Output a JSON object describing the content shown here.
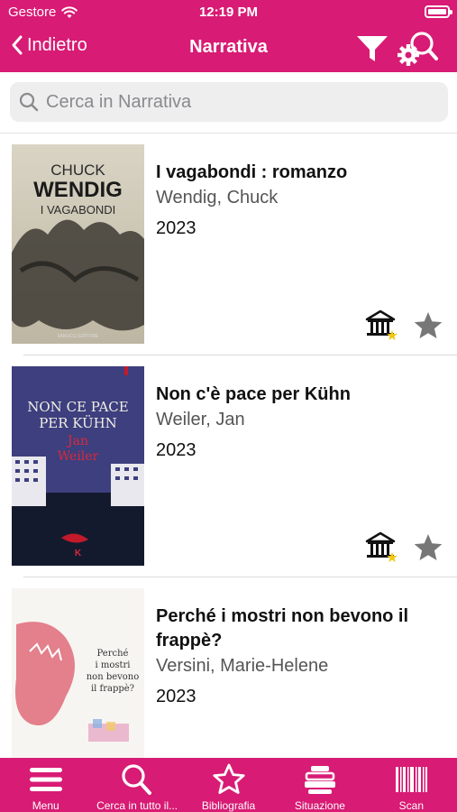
{
  "status_bar": {
    "carrier": "Gestore",
    "time": "12:19 PM"
  },
  "nav": {
    "back_label": "Indietro",
    "title": "Narrativa"
  },
  "search": {
    "placeholder": "Cerca in Narrativa"
  },
  "colors": {
    "brand": "#d81b74",
    "star_gray": "#777777",
    "star_yellow": "#f2c811"
  },
  "books": [
    {
      "title": "I vagabondi : romanzo",
      "author": "Wendig, Chuck",
      "year": "2023",
      "cover": {
        "line1": "CHUCK",
        "line2": "WENDIG",
        "line3": "I VAGABONDI",
        "publisher": "FANUCCI EDITORE"
      }
    },
    {
      "title": "Non c'è pace per Kühn",
      "author": "Weiler, Jan",
      "year": "2023",
      "cover": {
        "line1": "NON CE PACE",
        "line2": "PER KÜHN",
        "line3": "Jan",
        "line4": "Weiler",
        "publisher": "K"
      }
    },
    {
      "title": "Perché i mostri non bevono il frappè?",
      "author": "Versini, Marie-Helene",
      "year": "2023",
      "cover": {
        "line1": "Perché",
        "line2": "i mostri",
        "line3": "non bevono",
        "line4": "il frappè?"
      }
    }
  ],
  "tabs": [
    {
      "label": "Menu",
      "icon": "menu-icon"
    },
    {
      "label": "Cerca in tutto il...",
      "icon": "search-icon"
    },
    {
      "label": "Bibliografia",
      "icon": "star-outline-icon"
    },
    {
      "label": "Situazione",
      "icon": "stack-icon"
    },
    {
      "label": "Scan",
      "icon": "barcode-icon"
    }
  ]
}
